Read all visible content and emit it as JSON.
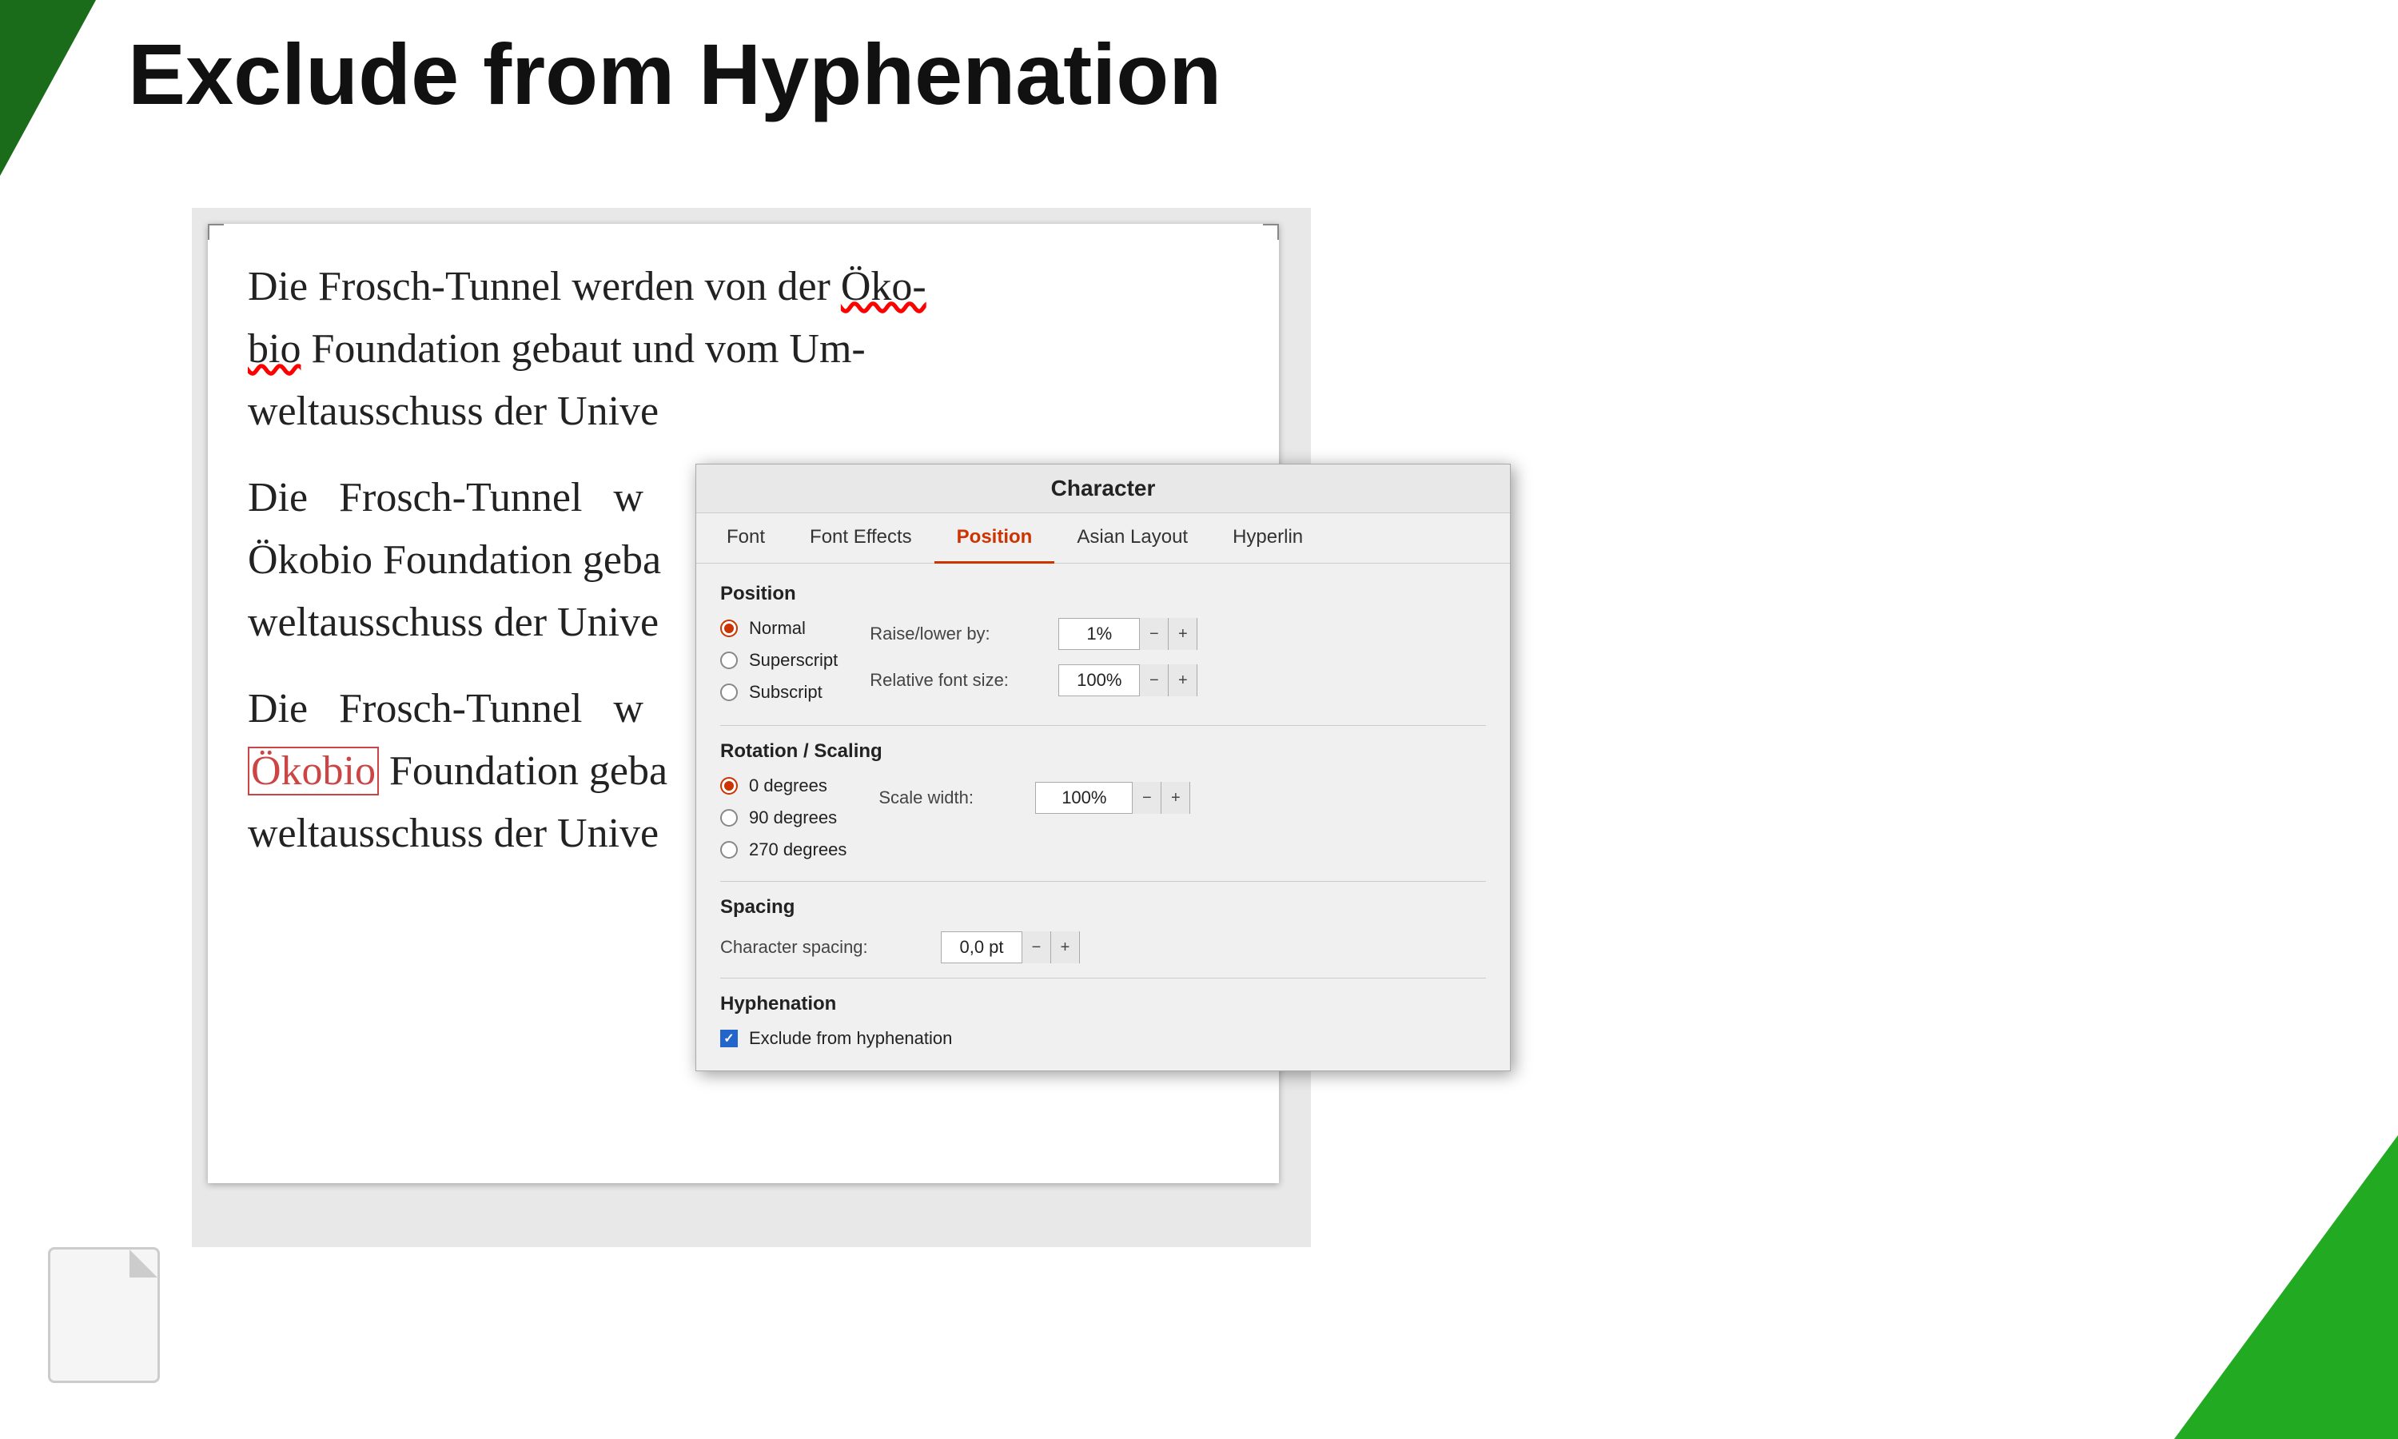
{
  "page": {
    "title": "Exclude from Hyphenation",
    "background": "#ffffff"
  },
  "doc": {
    "paragraph1_line1": "Die Frosch-Tunnel werden von der Öko-",
    "paragraph1_line2": "bio Foundation gebaut und vom Um-",
    "paragraph1_line3": "weltausschuss der Unive",
    "paragraph2_line1": "Die  Frosch-Tunnel  w",
    "paragraph2_line2": "Ökobio Foundation geba",
    "paragraph2_line3": "weltausschuss der Unive",
    "paragraph3_line1": "Die  Frosch-Tunnel  w",
    "paragraph3_word": "Ökobio",
    "paragraph3_line2": " Foundation geba",
    "paragraph3_line3": "weltausschuss der Unive"
  },
  "dialog": {
    "title": "Character",
    "tabs": [
      {
        "label": "Font",
        "active": false
      },
      {
        "label": "Font Effects",
        "active": false
      },
      {
        "label": "Position",
        "active": true
      },
      {
        "label": "Asian Layout",
        "active": false
      },
      {
        "label": "Hyperlin",
        "active": false
      }
    ],
    "position_section": {
      "title": "Position",
      "options": [
        {
          "label": "Normal",
          "selected": true
        },
        {
          "label": "Superscript",
          "selected": false
        },
        {
          "label": "Subscript",
          "selected": false
        }
      ],
      "raise_lower_label": "Raise/lower by:",
      "raise_lower_value": "1%",
      "relative_font_label": "Relative font size:",
      "relative_font_value": "100%"
    },
    "rotation_section": {
      "title": "Rotation / Scaling",
      "options": [
        {
          "label": "0 degrees",
          "selected": true
        },
        {
          "label": "90 degrees",
          "selected": false
        },
        {
          "label": "270 degrees",
          "selected": false
        }
      ],
      "scale_width_label": "Scale width:",
      "scale_width_value": "100%"
    },
    "spacing_section": {
      "title": "Spacing",
      "char_spacing_label": "Character spacing:",
      "char_spacing_value": "0,0 pt"
    },
    "hyphenation_section": {
      "title": "Hyphenation",
      "checkbox_label": "Exclude from hyphenation",
      "checked": true
    }
  },
  "icons": {
    "lo_icon": "document-icon"
  }
}
